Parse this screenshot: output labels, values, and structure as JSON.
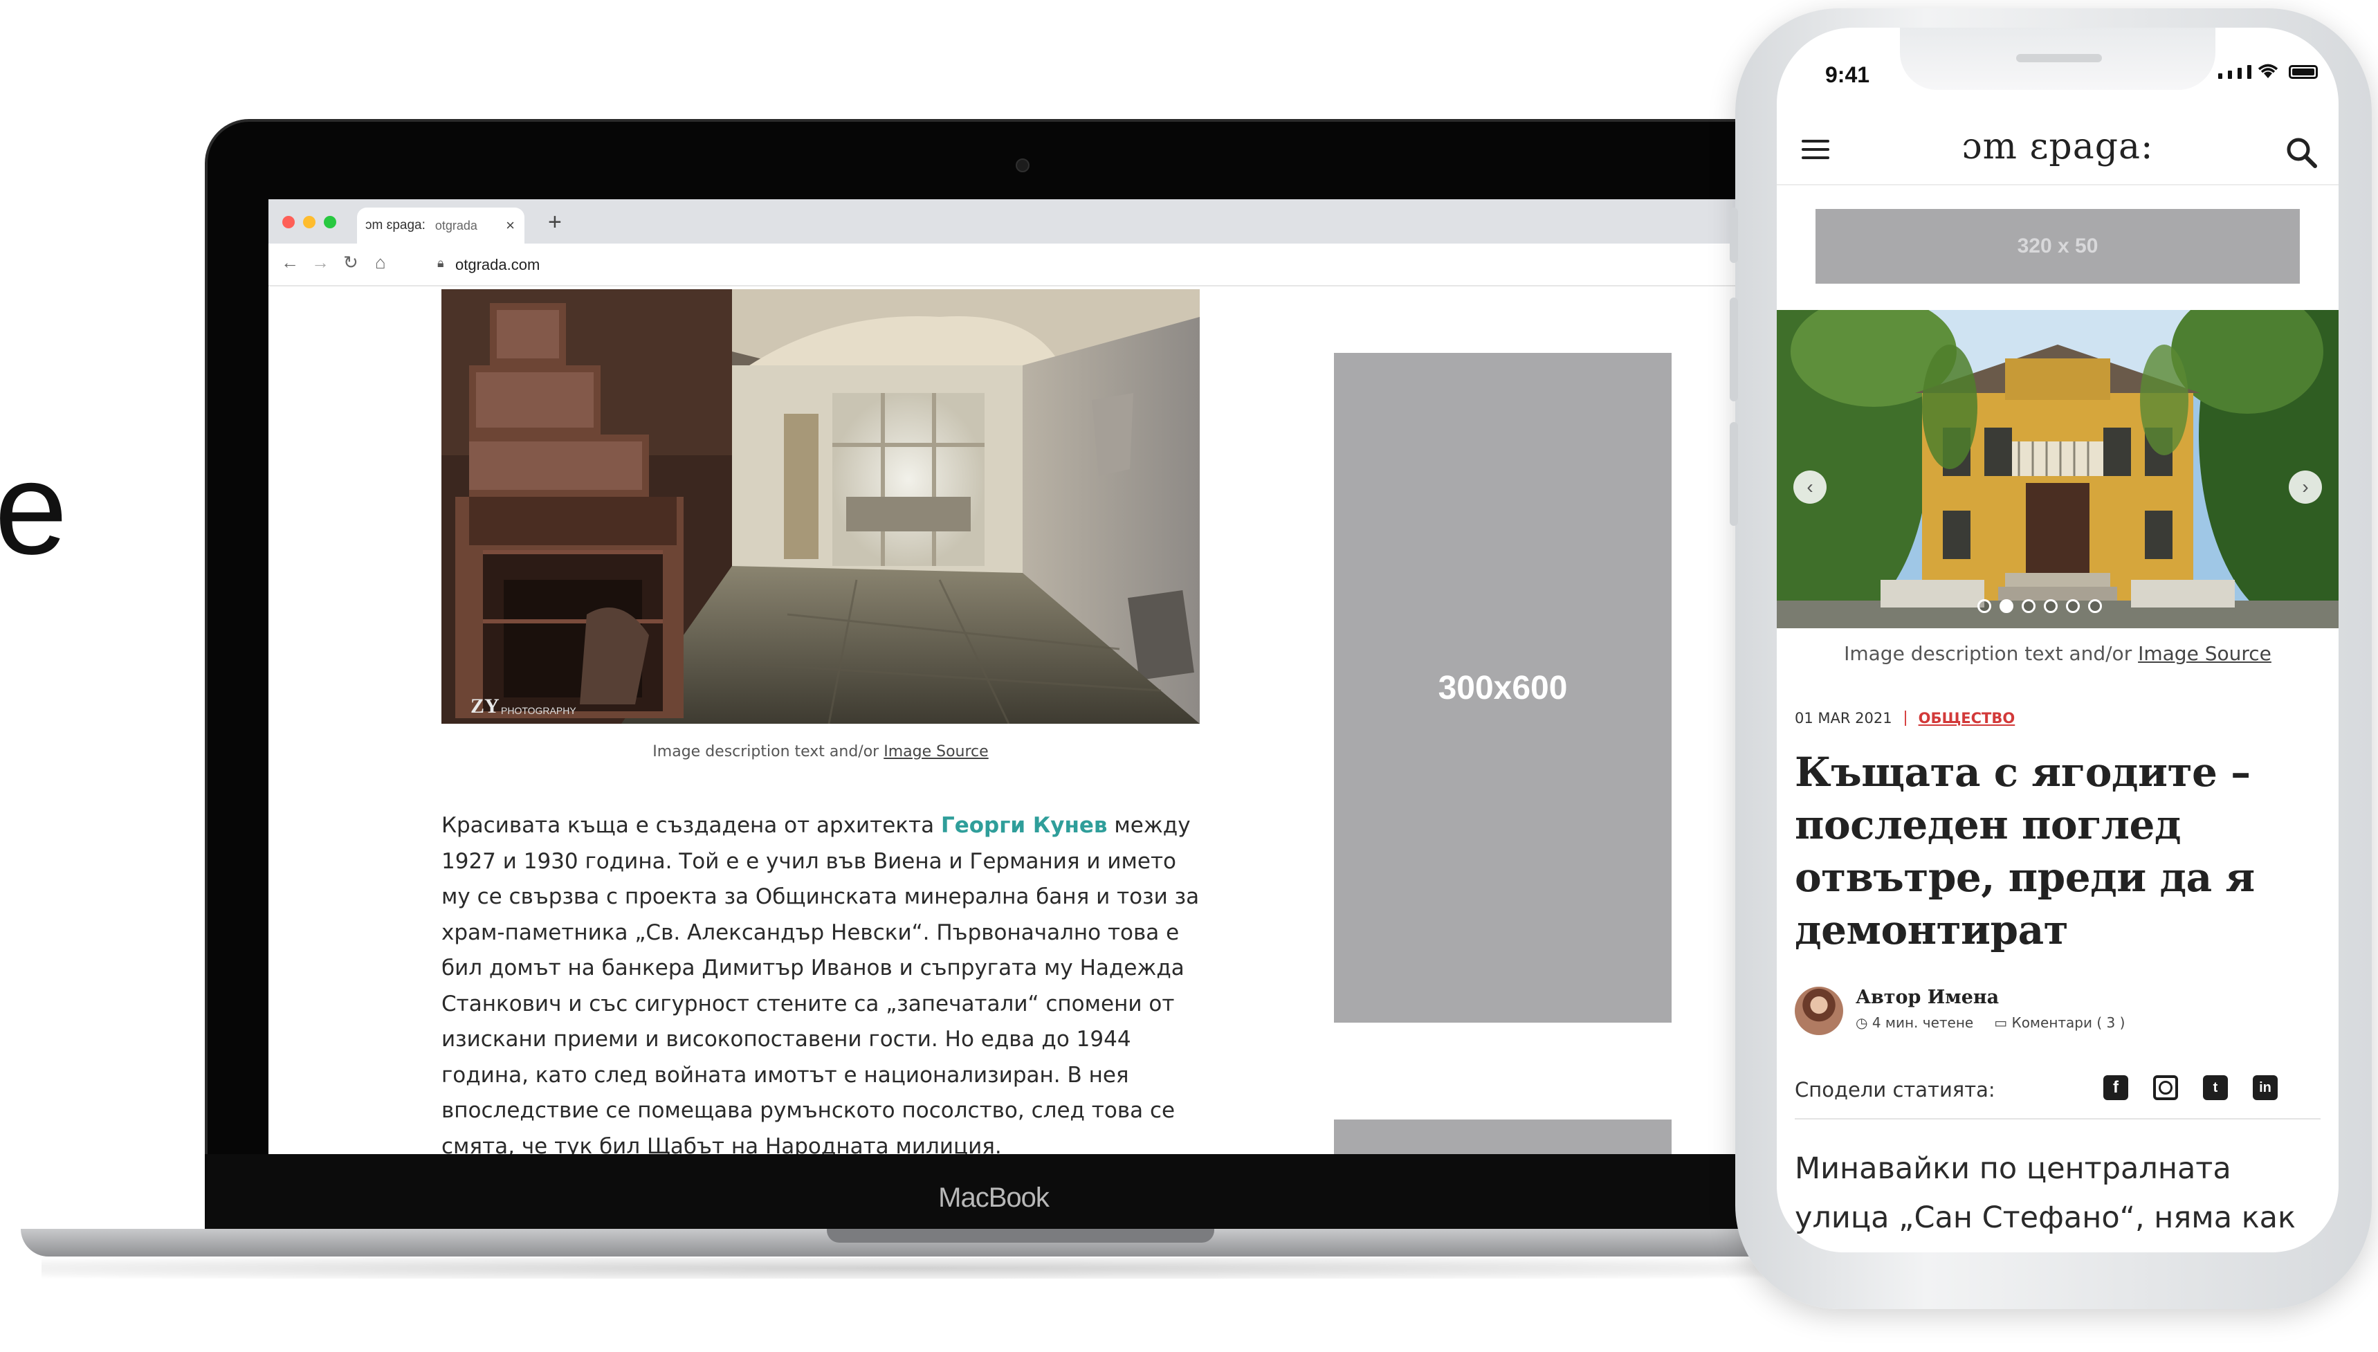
{
  "edge_glyph": "e",
  "laptop": {
    "brand_label": "MacBook",
    "browser": {
      "tab_title": "ɔm ɛpaga:",
      "tab_domain": "otgrada",
      "tab_close": "×",
      "new_tab": "+",
      "url": "otgrada.com"
    },
    "article": {
      "photo_watermark": "ZY PHOTOGRAPHY",
      "caption_text": "Image description text and/or ",
      "caption_link": "Image Source",
      "body_before_link": "Красивата къща е създадена от архитекта ",
      "body_link": "Георги Кунев",
      "body_after_link": " между 1927 и 1930 година. Той е е учил във Виена и Германия и името му се свързва с проекта за Общинската минерална баня и този за храм-паметника „Св. Александър Невски“. Първоначално това е бил домът на банкера Димитър Иванов и съпругата му Надежда Станкович и със сигурност стените са „запечатали“ спомени от изискани приеми и високопоставени гости. Но едва до 1944 година, като след войната имотът е национализиран. В нея впоследствие се помещава румънското посолство, след това се смята, че тук бил Щабът на Народната милиция."
    },
    "ad_tall_label": "300x600"
  },
  "phone": {
    "status": {
      "time": "9:41"
    },
    "logo": "ɔm ɛpaga:",
    "ad_banner_label": "320 x 50",
    "hero_caption_text": "Image description text and/or ",
    "hero_caption_link": "Image Source",
    "carousel": {
      "total": 6,
      "active": 2
    },
    "date": "01 MAR 2021",
    "category": "ОБЩЕСТВО",
    "headline": "Къщата с ягодите – последен поглед отвътре, преди да я демонтират",
    "author_name": "Автор Имена",
    "read_time": "4 мин. четене",
    "comments": "Коментари ( 3 )",
    "share_label": "Сподели статията:",
    "social": [
      "facebook-icon",
      "instagram-icon",
      "twitter-icon",
      "linkedin-icon"
    ],
    "body_start": "Минавайки по централната улица „Сан Стефано“, няма как да"
  },
  "colors": {
    "accent_link": "#2f9e9a",
    "category_red": "#d23939",
    "ad_grey": "#a9a9ab"
  }
}
